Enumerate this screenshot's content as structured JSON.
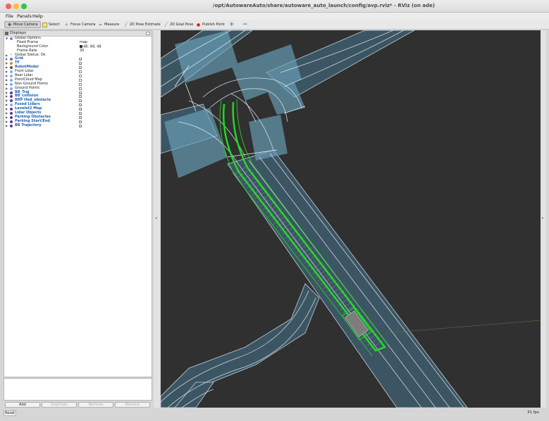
{
  "window": {
    "title": "/opt/AutowareAuto/share/autoware_auto_launch/config/avp.rviz* - RViz (on ade)"
  },
  "menu": [
    "File",
    "Panels",
    "Help"
  ],
  "toolbar": {
    "tools": [
      {
        "label": "Move Camera",
        "icon": "move-camera-icon",
        "active": true
      },
      {
        "label": "Select",
        "icon": "select-icon"
      },
      {
        "label": "Focus Camera",
        "icon": "focus-camera-icon"
      },
      {
        "label": "Measure",
        "icon": "measure-icon"
      },
      {
        "label": "2D Pose Estimate",
        "icon": "pose-estimate-icon"
      },
      {
        "label": "2D Goal Pose",
        "icon": "goal-pose-icon"
      },
      {
        "label": "Publish Point",
        "icon": "publish-point-icon"
      }
    ],
    "plus": "+",
    "minus": "−"
  },
  "displays": {
    "title": "Displays",
    "global_options": {
      "label": "Global Options",
      "fixed_frame_label": "Fixed Frame",
      "fixed_frame_value": "map",
      "background_color_label": "Background Color",
      "background_color_value": "48; 48; 48",
      "frame_rate_label": "Frame Rate",
      "frame_rate_value": "30"
    },
    "global_status": "Global Status: Ok",
    "items": [
      {
        "label": "Grid",
        "blue": true,
        "checked": true,
        "icon": "grid-icon"
      },
      {
        "label": "TF",
        "blue": true,
        "checked": true,
        "icon": "tf-icon"
      },
      {
        "label": "RobotModel",
        "blue": true,
        "checked": true,
        "icon": "robot-model-icon"
      },
      {
        "label": "Front Lidar",
        "blue": false,
        "checked": false,
        "icon": "pointcloud-icon"
      },
      {
        "label": "Rear Lidar",
        "blue": false,
        "checked": false,
        "icon": "pointcloud-icon"
      },
      {
        "label": "PointCloud Map",
        "blue": false,
        "checked": false,
        "icon": "pointcloud-icon"
      },
      {
        "label": "Non-Ground Points",
        "blue": false,
        "checked": false,
        "icon": "pointcloud-icon"
      },
      {
        "label": "Ground Points",
        "blue": false,
        "checked": false,
        "icon": "pointcloud-icon"
      },
      {
        "label": "BB_Traj",
        "blue": true,
        "checked": true,
        "icon": "marker-icon"
      },
      {
        "label": "BB_collision",
        "blue": true,
        "checked": true,
        "icon": "marker-icon"
      },
      {
        "label": "RRP tfed_obstacle",
        "blue": true,
        "checked": true,
        "icon": "marker-icon"
      },
      {
        "label": "Fused Lidars",
        "blue": true,
        "checked": true,
        "icon": "pointcloud-icon"
      },
      {
        "label": "Lanelet2 Map",
        "blue": true,
        "checked": true,
        "icon": "marker-icon"
      },
      {
        "label": "Lidar Objects",
        "blue": true,
        "checked": true,
        "icon": "marker-icon"
      },
      {
        "label": "Parking Obstacles",
        "blue": true,
        "checked": true,
        "icon": "marker-icon"
      },
      {
        "label": "Parking Start/End",
        "blue": true,
        "checked": true,
        "icon": "marker-icon"
      },
      {
        "label": "BB Trajectory",
        "blue": true,
        "checked": true,
        "icon": "marker-icon"
      }
    ]
  },
  "buttons": {
    "add": "Add",
    "duplicate": "Duplicate",
    "remove": "Remove",
    "rename": "Rename"
  },
  "reset": "Reset",
  "fps": "31 fps",
  "colors": {
    "viewport_bg": "#303030",
    "road": "#3d5866",
    "trajectory": "#22dd22",
    "lane_line": "#e6f0f5"
  }
}
